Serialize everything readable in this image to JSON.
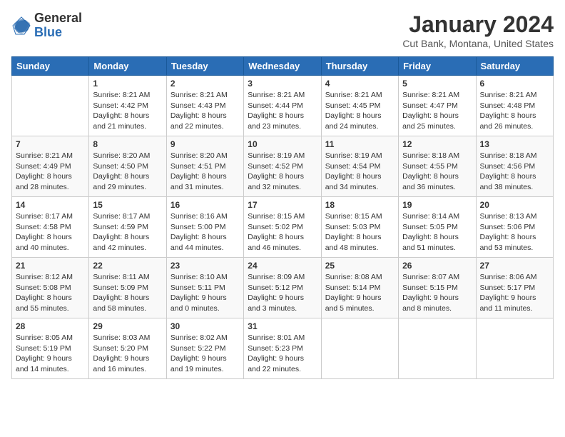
{
  "logo": {
    "general": "General",
    "blue": "Blue"
  },
  "title": "January 2024",
  "location": "Cut Bank, Montana, United States",
  "headers": [
    "Sunday",
    "Monday",
    "Tuesday",
    "Wednesday",
    "Thursday",
    "Friday",
    "Saturday"
  ],
  "weeks": [
    [
      {
        "day": "",
        "info": ""
      },
      {
        "day": "1",
        "info": "Sunrise: 8:21 AM\nSunset: 4:42 PM\nDaylight: 8 hours\nand 21 minutes."
      },
      {
        "day": "2",
        "info": "Sunrise: 8:21 AM\nSunset: 4:43 PM\nDaylight: 8 hours\nand 22 minutes."
      },
      {
        "day": "3",
        "info": "Sunrise: 8:21 AM\nSunset: 4:44 PM\nDaylight: 8 hours\nand 23 minutes."
      },
      {
        "day": "4",
        "info": "Sunrise: 8:21 AM\nSunset: 4:45 PM\nDaylight: 8 hours\nand 24 minutes."
      },
      {
        "day": "5",
        "info": "Sunrise: 8:21 AM\nSunset: 4:47 PM\nDaylight: 8 hours\nand 25 minutes."
      },
      {
        "day": "6",
        "info": "Sunrise: 8:21 AM\nSunset: 4:48 PM\nDaylight: 8 hours\nand 26 minutes."
      }
    ],
    [
      {
        "day": "7",
        "info": "Sunrise: 8:21 AM\nSunset: 4:49 PM\nDaylight: 8 hours\nand 28 minutes."
      },
      {
        "day": "8",
        "info": "Sunrise: 8:20 AM\nSunset: 4:50 PM\nDaylight: 8 hours\nand 29 minutes."
      },
      {
        "day": "9",
        "info": "Sunrise: 8:20 AM\nSunset: 4:51 PM\nDaylight: 8 hours\nand 31 minutes."
      },
      {
        "day": "10",
        "info": "Sunrise: 8:19 AM\nSunset: 4:52 PM\nDaylight: 8 hours\nand 32 minutes."
      },
      {
        "day": "11",
        "info": "Sunrise: 8:19 AM\nSunset: 4:54 PM\nDaylight: 8 hours\nand 34 minutes."
      },
      {
        "day": "12",
        "info": "Sunrise: 8:18 AM\nSunset: 4:55 PM\nDaylight: 8 hours\nand 36 minutes."
      },
      {
        "day": "13",
        "info": "Sunrise: 8:18 AM\nSunset: 4:56 PM\nDaylight: 8 hours\nand 38 minutes."
      }
    ],
    [
      {
        "day": "14",
        "info": "Sunrise: 8:17 AM\nSunset: 4:58 PM\nDaylight: 8 hours\nand 40 minutes."
      },
      {
        "day": "15",
        "info": "Sunrise: 8:17 AM\nSunset: 4:59 PM\nDaylight: 8 hours\nand 42 minutes."
      },
      {
        "day": "16",
        "info": "Sunrise: 8:16 AM\nSunset: 5:00 PM\nDaylight: 8 hours\nand 44 minutes."
      },
      {
        "day": "17",
        "info": "Sunrise: 8:15 AM\nSunset: 5:02 PM\nDaylight: 8 hours\nand 46 minutes."
      },
      {
        "day": "18",
        "info": "Sunrise: 8:15 AM\nSunset: 5:03 PM\nDaylight: 8 hours\nand 48 minutes."
      },
      {
        "day": "19",
        "info": "Sunrise: 8:14 AM\nSunset: 5:05 PM\nDaylight: 8 hours\nand 51 minutes."
      },
      {
        "day": "20",
        "info": "Sunrise: 8:13 AM\nSunset: 5:06 PM\nDaylight: 8 hours\nand 53 minutes."
      }
    ],
    [
      {
        "day": "21",
        "info": "Sunrise: 8:12 AM\nSunset: 5:08 PM\nDaylight: 8 hours\nand 55 minutes."
      },
      {
        "day": "22",
        "info": "Sunrise: 8:11 AM\nSunset: 5:09 PM\nDaylight: 8 hours\nand 58 minutes."
      },
      {
        "day": "23",
        "info": "Sunrise: 8:10 AM\nSunset: 5:11 PM\nDaylight: 9 hours\nand 0 minutes."
      },
      {
        "day": "24",
        "info": "Sunrise: 8:09 AM\nSunset: 5:12 PM\nDaylight: 9 hours\nand 3 minutes."
      },
      {
        "day": "25",
        "info": "Sunrise: 8:08 AM\nSunset: 5:14 PM\nDaylight: 9 hours\nand 5 minutes."
      },
      {
        "day": "26",
        "info": "Sunrise: 8:07 AM\nSunset: 5:15 PM\nDaylight: 9 hours\nand 8 minutes."
      },
      {
        "day": "27",
        "info": "Sunrise: 8:06 AM\nSunset: 5:17 PM\nDaylight: 9 hours\nand 11 minutes."
      }
    ],
    [
      {
        "day": "28",
        "info": "Sunrise: 8:05 AM\nSunset: 5:19 PM\nDaylight: 9 hours\nand 14 minutes."
      },
      {
        "day": "29",
        "info": "Sunrise: 8:03 AM\nSunset: 5:20 PM\nDaylight: 9 hours\nand 16 minutes."
      },
      {
        "day": "30",
        "info": "Sunrise: 8:02 AM\nSunset: 5:22 PM\nDaylight: 9 hours\nand 19 minutes."
      },
      {
        "day": "31",
        "info": "Sunrise: 8:01 AM\nSunset: 5:23 PM\nDaylight: 9 hours\nand 22 minutes."
      },
      {
        "day": "",
        "info": ""
      },
      {
        "day": "",
        "info": ""
      },
      {
        "day": "",
        "info": ""
      }
    ]
  ]
}
